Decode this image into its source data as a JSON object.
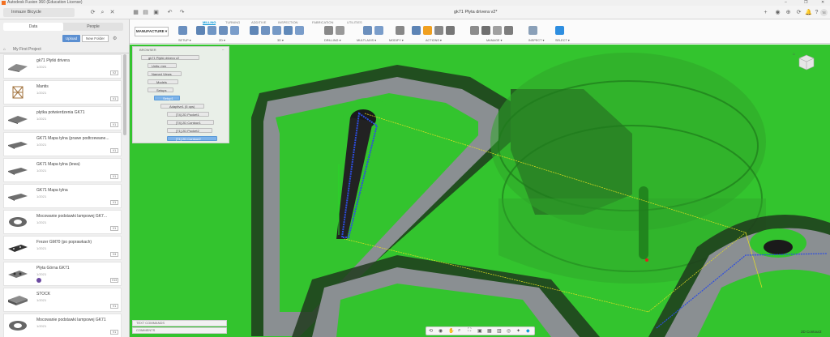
{
  "window": {
    "title": "Autodesk Fusion 360 (Education License)",
    "controls": [
      "–",
      "❐",
      "✕"
    ]
  },
  "header": {
    "team": "Inmaze Bicycle",
    "doc_tab": "gk71 Płyta drivera v2*",
    "right_icons": [
      "+",
      "◉",
      "⊕",
      "⟳",
      "🔔",
      "?",
      "TE"
    ]
  },
  "toolbar": {
    "workspace": "MANUFACTURE ▾",
    "tabs": [
      "MILLING",
      "TURNING",
      "ADDITIVE",
      "INSPECTION",
      "FABRICATION",
      "UTILITIES"
    ],
    "active_tab": "MILLING",
    "groups": [
      "SETUP ▾",
      "2D ▾",
      "3D ▾",
      "DRILLING ▾",
      "MULTI-AXIS ▾",
      "MODIFY ▾",
      "ACTIONS ▾",
      "MANAGE ▾",
      "INSPECT ▾",
      "SELECT ▾"
    ],
    "accent": "#0696d7"
  },
  "data_panel": {
    "segment_data": "Data",
    "segment_people": "People",
    "upload": "Upload",
    "new_folder": "New Folder",
    "breadcrumb": "My First Project",
    "items": [
      {
        "name": "gk71 Płytki drivera",
        "version": "1/2021",
        "badge": "V2"
      },
      {
        "name": "Mantis",
        "version": "1/2021",
        "badge": "V1"
      },
      {
        "name": "płytka potwierdzenia GK71",
        "version": "1/2021",
        "badge": "V1"
      },
      {
        "name": "GK71   Mapa tylna (prawe podtrzewane...",
        "version": "1/2021",
        "badge": "V1"
      },
      {
        "name": "GK71   Mapa tylna (lewa)",
        "version": "1/2021",
        "badge": "V1"
      },
      {
        "name": "GK71   Mapa tylna",
        "version": "1/2021",
        "badge": "V1"
      },
      {
        "name": "Mocowanie podstawki lampowej GK7...",
        "version": "1/2021",
        "badge": "V1"
      },
      {
        "name": "Frezer GM70 (po poprawkach)",
        "version": "1/2021",
        "badge": "V4"
      },
      {
        "name": "Płyta Górna GK71",
        "version": "1/2021",
        "badge": "V13"
      },
      {
        "name": "STOCK",
        "version": "1/2021",
        "badge": "V1"
      },
      {
        "name": "Mocowanie podstawki lampowej GK71",
        "version": "1/2021",
        "badge": "V1"
      }
    ]
  },
  "browser": {
    "title": "BROWSER",
    "root": "gk71 Płytki drivera v2",
    "rows": [
      "Units: mm",
      "Named Views",
      "Models",
      "Setups",
      "Setup1",
      "Adaptive1 (5 ops)",
      "[T4] 2D Pocket1",
      "[T4] 2D Contour1",
      "[T1] 2D Pocket2",
      "[T1] 2D Contour2"
    ]
  },
  "bottom_panels": {
    "text_commands": "TEXT COMMANDS",
    "comments": "COMMENTS"
  },
  "status": {
    "selection": "2D Contour2"
  }
}
